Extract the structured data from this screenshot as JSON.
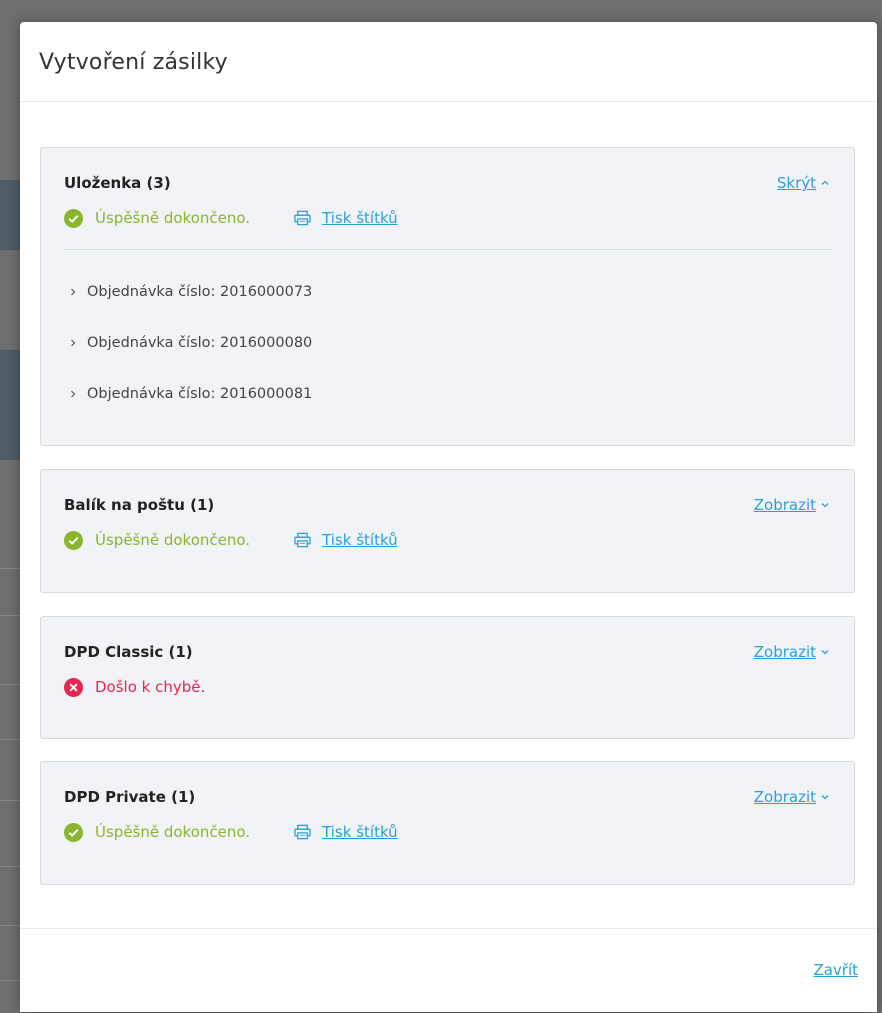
{
  "modal": {
    "title": "Vytvoření zásilky",
    "close_label": "Zavřít"
  },
  "colors": {
    "accent": "#2aa0d8",
    "success": "#8ab52c",
    "error": "#e8254e",
    "panel_bg": "#f1f3f6"
  },
  "panels": [
    {
      "name": "Uloženka (3)",
      "toggle_label": "Skrýt",
      "toggle_icon": "chevron-up-icon",
      "status": "success",
      "status_text": "Úspěšně dokončeno.",
      "print_label": "Tisk štítků",
      "orders": [
        "Objednávka číslo: 2016000073",
        "Objednávka číslo: 2016000080",
        "Objednávka číslo: 2016000081"
      ]
    },
    {
      "name": "Balík na poštu (1)",
      "toggle_label": "Zobrazit",
      "toggle_icon": "chevron-down-icon",
      "status": "success",
      "status_text": "Úspěšně dokončeno.",
      "print_label": "Tisk štítků"
    },
    {
      "name": "DPD Classic (1)",
      "toggle_label": "Zobrazit",
      "toggle_icon": "chevron-down-icon",
      "status": "error",
      "status_text": "Došlo k chybě."
    },
    {
      "name": "DPD Private (1)",
      "toggle_label": "Zobrazit",
      "toggle_icon": "chevron-down-icon",
      "status": "success",
      "status_text": "Úspěšně dokončeno.",
      "print_label": "Tisk štítků"
    }
  ]
}
